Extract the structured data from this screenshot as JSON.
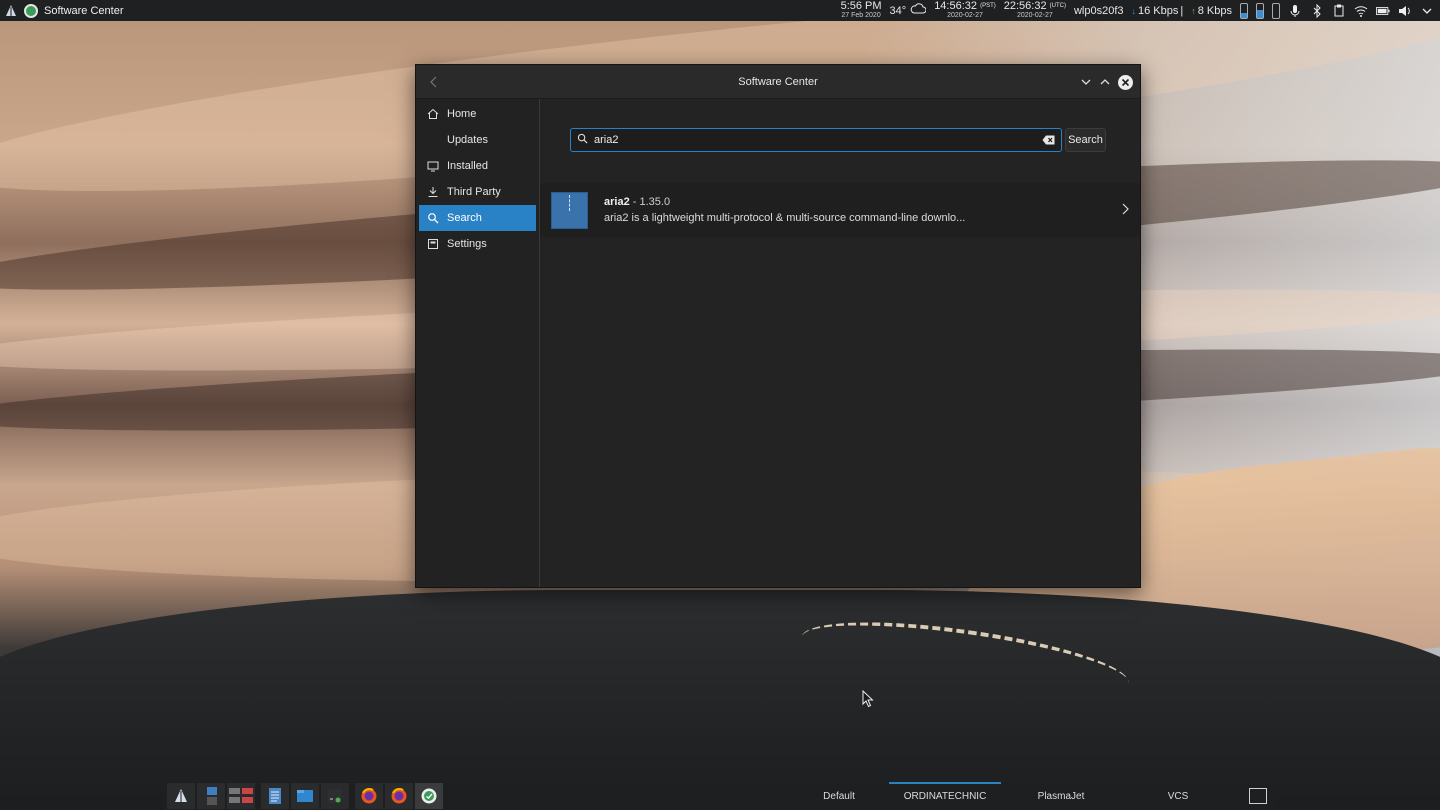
{
  "top_panel": {
    "app_title": "Software Center",
    "clock_time": "5:56 PM",
    "clock_date": "27 Feb 2020",
    "temperature": "34°",
    "weather_icon": "cloud-icon",
    "pst_time": "14:56:32",
    "pst_label": "(PST)",
    "pst_date": "2020-02-27",
    "utc_time": "22:56:32",
    "utc_label": "(UTC)",
    "utc_date": "2020-02-27",
    "network_interface": "wlp0s20f3",
    "download_rate": "16 Kbps",
    "rate_separator": "|",
    "upload_rate": "8 Kbps"
  },
  "window": {
    "title": "Software Center",
    "sidebar": {
      "items": [
        {
          "label": "Home",
          "icon": "home-icon",
          "active": false
        },
        {
          "label": "Updates",
          "icon": "updates-icon",
          "active": false
        },
        {
          "label": "Installed",
          "icon": "monitor-icon",
          "active": false
        },
        {
          "label": "Third Party",
          "icon": "download-icon",
          "active": false
        },
        {
          "label": "Search",
          "icon": "search-icon",
          "active": true
        },
        {
          "label": "Settings",
          "icon": "settings-icon",
          "active": false
        }
      ]
    },
    "search": {
      "value": "aria2",
      "button_label": "Search"
    },
    "results": [
      {
        "name": "aria2",
        "version_sep": " - ",
        "version": "1.35.0",
        "description": "aria2 is a lightweight multi-protocol & multi-source command-line downlo..."
      }
    ]
  },
  "taskbar": {
    "activities": [
      {
        "label": "Default",
        "active": false
      },
      {
        "label": "ORDINATECHNIC",
        "active": true
      },
      {
        "label": "PlasmaJet",
        "active": false
      },
      {
        "label": "VCS",
        "active": false
      }
    ]
  },
  "colors": {
    "accent": "#2a82c6",
    "window_bg": "#232323",
    "panel_bg": "#1f2022"
  }
}
